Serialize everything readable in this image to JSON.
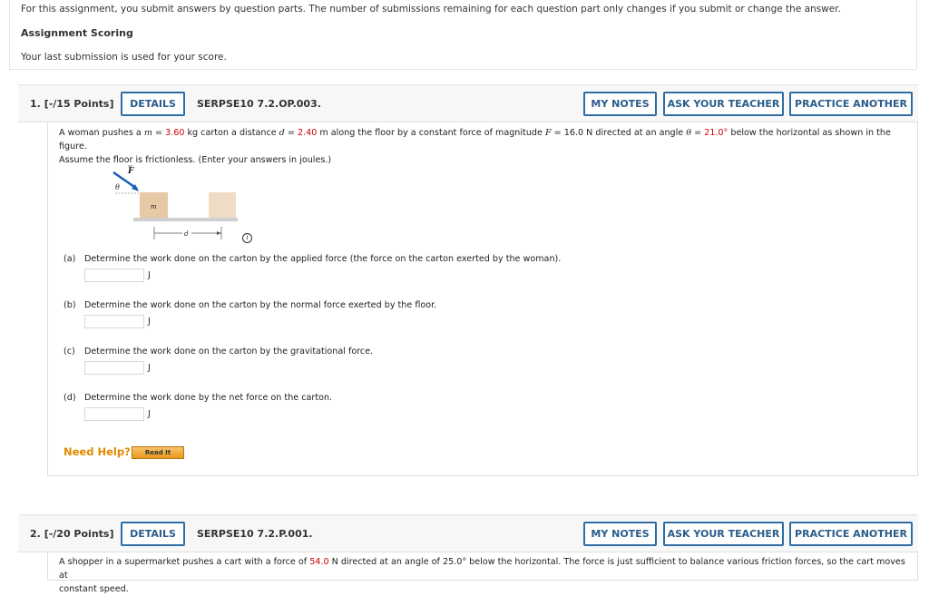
{
  "info": {
    "line1": "For this assignment, you submit answers by question parts. The number of submissions remaining for each question part only changes if you submit or change the answer.",
    "heading": "Assignment Scoring",
    "line2": "Your last submission is used for your score."
  },
  "questions": [
    {
      "number": "1.",
      "points": "[-/15 Points]",
      "details_label": "DETAILS",
      "code": "SERPSE10 7.2.OP.003.",
      "my_notes_label": "MY NOTES",
      "ask_teacher_label": "ASK YOUR TEACHER",
      "practice_label": "PRACTICE ANOTHER",
      "problem": {
        "t1": "A woman pushes a ",
        "m_sym": "m",
        "eq1": " = ",
        "m_val": "3.60",
        "t2": " kg carton a distance ",
        "d_sym": "d",
        "eq2": " = ",
        "d_val": "2.40",
        "t3": " m along the floor by a constant force of magnitude ",
        "f_sym": "F",
        "t4": " = 16.0 N directed at an angle ",
        "theta_sym": "θ",
        "eq3": " = ",
        "theta_val": "21.0°",
        "t5": " below the horizontal as shown in the figure.",
        "t6": "Assume the floor is frictionless. (Enter your answers in joules.)"
      },
      "figure": {
        "f_label": "F",
        "theta_label": "θ",
        "m_label": "m",
        "d_label": "d",
        "info_label": "i"
      },
      "parts": [
        {
          "label": "(a)",
          "text": "Determine the work done on the carton by the applied force (the force on the carton exerted by the woman).",
          "value": "",
          "unit": "J"
        },
        {
          "label": "(b)",
          "text": "Determine the work done on the carton by the normal force exerted by the floor.",
          "value": "",
          "unit": "J"
        },
        {
          "label": "(c)",
          "text": "Determine the work done on the carton by the gravitational force.",
          "value": "",
          "unit": "J"
        },
        {
          "label": "(d)",
          "text": "Determine the work done by the net force on the carton.",
          "value": "",
          "unit": "J"
        }
      ],
      "need_help": "Need Help?",
      "read_it": "Read It"
    },
    {
      "number": "2.",
      "points": "[-/20 Points]",
      "details_label": "DETAILS",
      "code": "SERPSE10 7.2.P.001.",
      "my_notes_label": "MY NOTES",
      "ask_teacher_label": "ASK YOUR TEACHER",
      "practice_label": "PRACTICE ANOTHER",
      "problem": {
        "t1": "A shopper in a supermarket pushes a cart with a force of ",
        "f_val": "54.0",
        "t2": " N directed at an angle of 25.0° below the horizontal. The force is just sufficient to balance various friction forces, so the cart moves at",
        "t3": "constant speed."
      }
    }
  ],
  "colors": {
    "accent_blue": "#2e6da4",
    "value_red": "#cc0000",
    "help_orange": "#e08a00",
    "carton": "#e8c9a5"
  }
}
